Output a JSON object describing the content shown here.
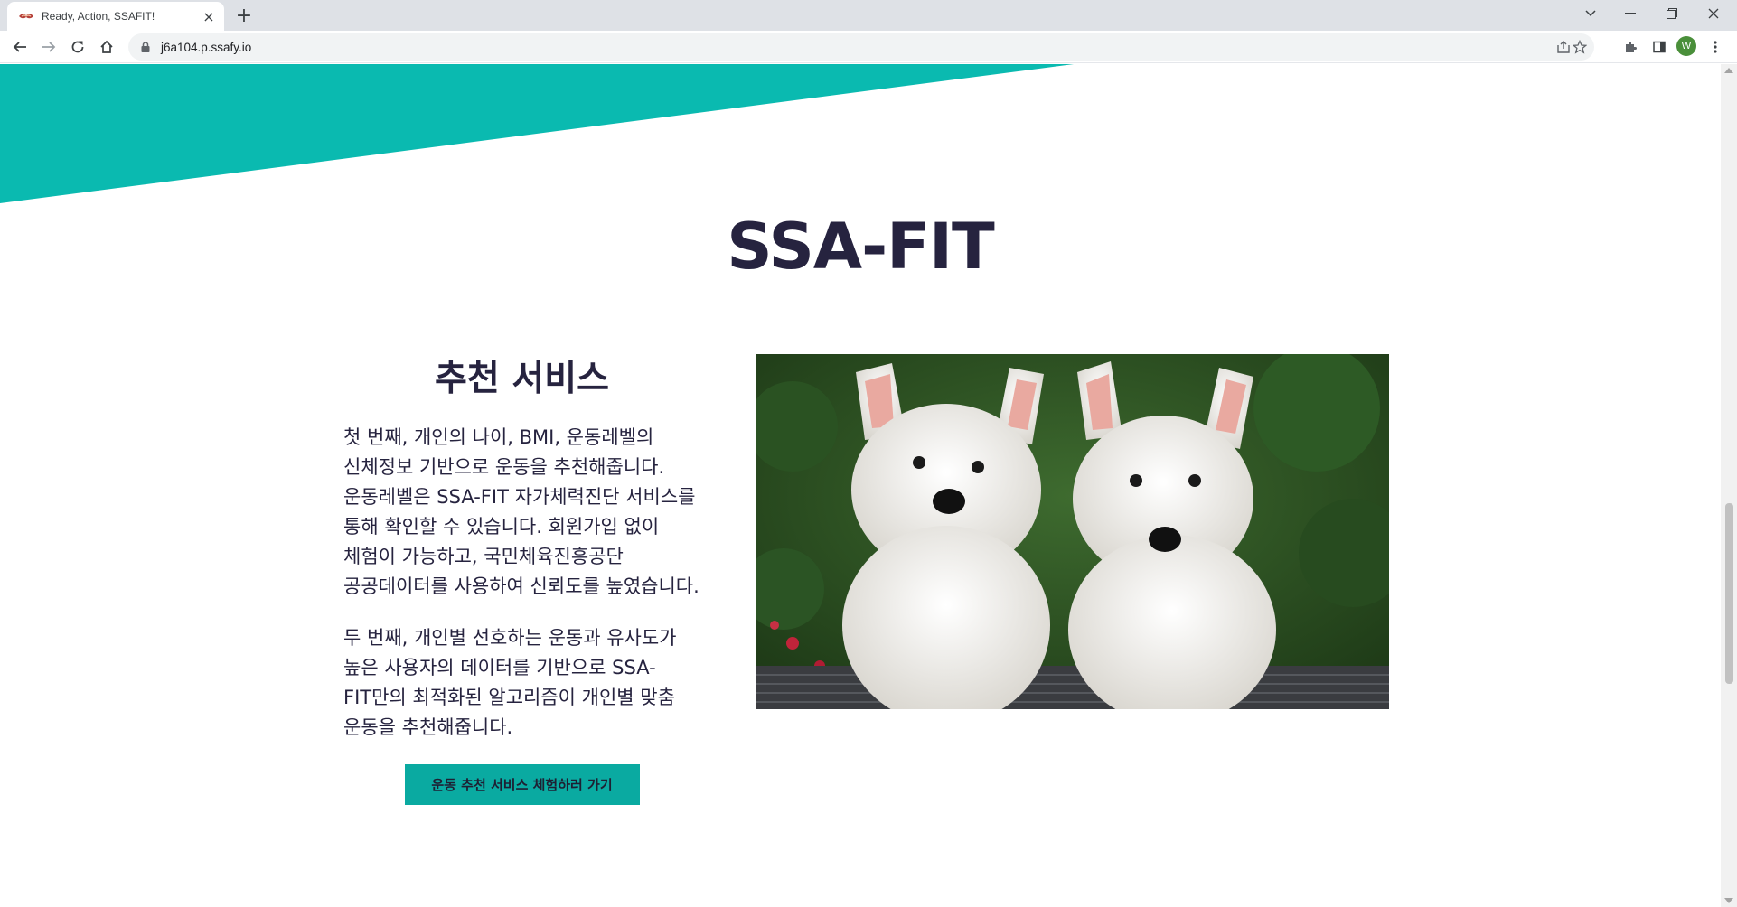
{
  "browser": {
    "tab_title": "Ready, Action, SSAFIT!",
    "tab_close": "×",
    "new_tab": "+",
    "url": "j6a104.p.ssafy.io",
    "profile_initial": "W"
  },
  "colors": {
    "accent": "#0abab0",
    "heading": "#26233f",
    "button_bg": "#0aaaa1"
  },
  "page": {
    "title": "SSA-FIT",
    "section": {
      "heading": "추천 서비스",
      "paragraphs": [
        "첫 번째, 개인의 나이, BMI, 운동레벨의 신체정보 기반으로 운동을 추천해줍니다. 운동레벨은 SSA-FIT 자가체력진단 서비스를 통해 확인할 수 있습니다. 회원가입 없이 체험이 가능하고, 국민체육진흥공단 공공데이터를 사용하여 신뢰도를 높였습니다.",
        "두 번째, 개인별 선호하는 운동과 유사도가 높은 사용자의 데이터를 기반으로 SSA-FIT만의 최적화된 알고리즘이 개인별 맞춤 운동을 추천해줍니다."
      ],
      "button_label": "운동 추천 서비스 체험하러 가기"
    }
  },
  "icons": [
    "favicon-icon",
    "close-icon",
    "new-tab-icon",
    "tab-search-icon",
    "minimize-icon",
    "restore-icon",
    "window-close-icon",
    "back-icon",
    "forward-icon",
    "reload-icon",
    "home-icon",
    "lock-icon",
    "share-icon",
    "bookmark-star-icon",
    "extensions-icon",
    "side-panel-icon",
    "menu-icon"
  ]
}
